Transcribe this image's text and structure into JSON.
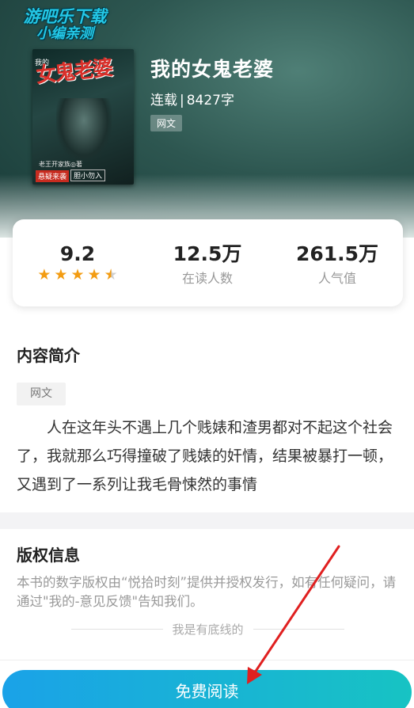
{
  "watermark": {
    "line1": "游吧乐下载",
    "line2": "小编亲测"
  },
  "cover": {
    "title_art": "女鬼老婆",
    "small_mark": "我的",
    "author": "老王开家族◎著",
    "tag": "悬疑来袭",
    "tag2": "胆小勿入"
  },
  "book": {
    "title": "我的女鬼老婆",
    "status": "连载",
    "separator": "|",
    "word_count": "8427字",
    "genre": "网文"
  },
  "stats": {
    "rating": "9.2",
    "rating_stars": 4.5,
    "readers_value": "12.5万",
    "readers_label": "在读人数",
    "popularity_value": "261.5万",
    "popularity_label": "人气值"
  },
  "intro": {
    "heading": "内容简介",
    "tag": "网文",
    "text": "人在这年头不遇上几个贱婊和渣男都对不起这个社会了，我就那么巧得撞破了贱婊的奸情，结果被暴打一顿，又遇到了一系列让我毛骨悚然的事情"
  },
  "copyright": {
    "heading": "版权信息",
    "text": "本书的数字版权由“悦拾时刻”提供并授权发行，如有任何疑问，请通过\"我的-意见反馈\"告知我们。",
    "bottom_line": "我是有底线的"
  },
  "read_button": {
    "label": "免费阅读"
  },
  "colors": {
    "accent_start": "#1aa2e8",
    "accent_end": "#17c3c3",
    "star": "#f39c12",
    "annotation_arrow": "#e02020"
  },
  "icons": {
    "star_full": "star-icon",
    "star_half": "star-half-icon"
  }
}
